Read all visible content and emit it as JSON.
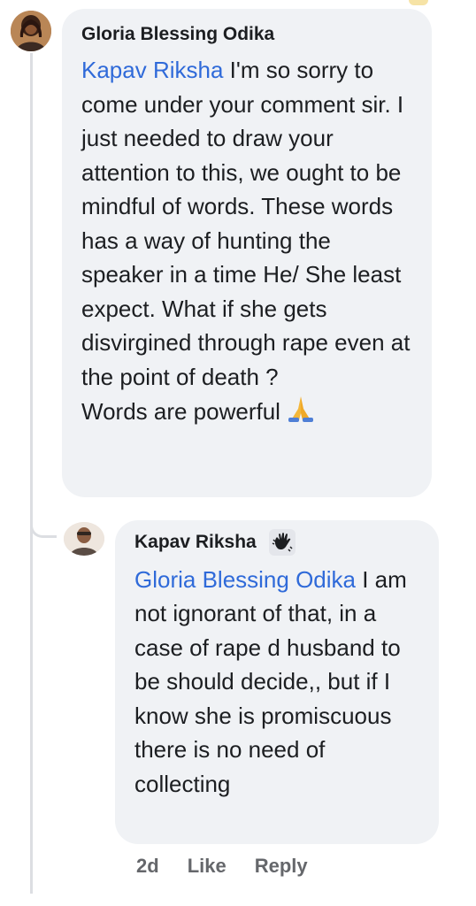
{
  "comment": {
    "author": "Gloria Blessing Odika",
    "mention": "Kapav Riksha",
    "text": " I'm so sorry to come under your comment sir. I just needed to draw your attention to this, we ought to be mindful of words. These words has a way of hunting the speaker in a time He/ She least expect. What if she gets disvirgined through rape even at the point of death ?\nWords are powerful",
    "emoji": "folded-hands-icon"
  },
  "reply": {
    "author": "Kapav Riksha",
    "badge": "waving-hand-badge-icon",
    "mention": "Gloria Blessing Odika",
    "text": " I am not ignorant of that, in a case of rape d husband to be should decide,, but if I know she is promiscuous there is no need of collecting",
    "timestamp": "2d",
    "like_label": "Like",
    "reply_label": "Reply"
  },
  "colors": {
    "bubble": "#f0f2f5",
    "mention": "#2f6ad9",
    "meta_text": "#65676b"
  }
}
